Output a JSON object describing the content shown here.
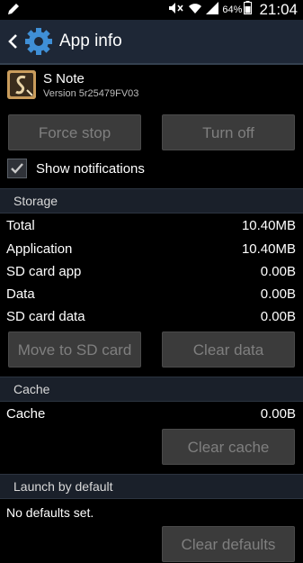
{
  "status_bar": {
    "battery": "64%",
    "time": "21:04",
    "icons": [
      "edit-icon",
      "mute-icon",
      "wifi-icon",
      "signal-icon",
      "battery-icon"
    ]
  },
  "action_bar": {
    "title": "App info",
    "icons": [
      "back-chevron-icon",
      "settings-gear-icon"
    ]
  },
  "app": {
    "name": "S Note",
    "version": "Version 5r25479FV03",
    "icon": "s-note-app-icon"
  },
  "buttons": {
    "force_stop": "Force stop",
    "turn_off": "Turn off",
    "move_to_sd": "Move to SD card",
    "clear_data": "Clear data",
    "clear_cache": "Clear cache",
    "clear_defaults": "Clear defaults"
  },
  "notifications": {
    "label": "Show notifications",
    "checked": true
  },
  "storage": {
    "header": "Storage",
    "rows": [
      {
        "label": "Total",
        "value": "10.40MB"
      },
      {
        "label": "Application",
        "value": "10.40MB"
      },
      {
        "label": "SD card app",
        "value": "0.00B"
      },
      {
        "label": "Data",
        "value": "0.00B"
      },
      {
        "label": "SD card data",
        "value": "0.00B"
      }
    ]
  },
  "cache": {
    "header": "Cache",
    "rows": [
      {
        "label": "Cache",
        "value": "0.00B"
      }
    ]
  },
  "launch": {
    "header": "Launch by default",
    "text": "No defaults set."
  }
}
